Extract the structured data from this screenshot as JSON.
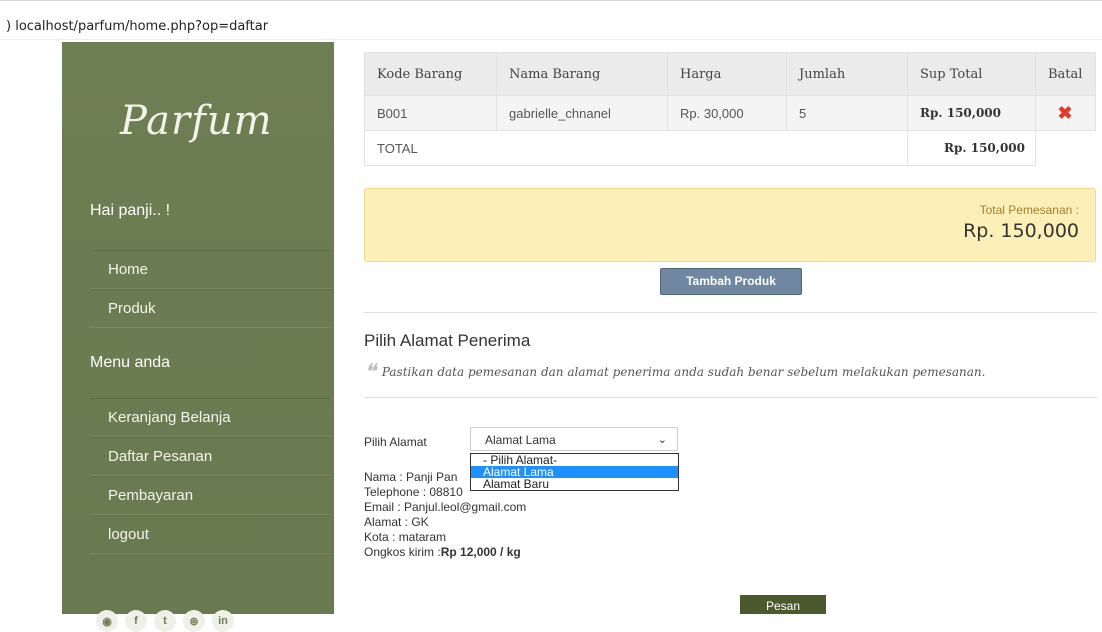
{
  "browser": {
    "url": ") localhost/parfum/home.php?op=daftar"
  },
  "sidebar": {
    "logo": "Parfum",
    "greeting": "Hai panji.. !",
    "main_nav": [
      {
        "label": "Home"
      },
      {
        "label": "Produk"
      }
    ],
    "menu_heading": "Menu anda",
    "user_nav": [
      {
        "label": "Keranjang Belanja"
      },
      {
        "label": "Daftar Pesanan"
      },
      {
        "label": "Pembayaran"
      },
      {
        "label": "logout"
      }
    ],
    "social_icons": [
      "rss-icon",
      "facebook-icon",
      "twitter-icon",
      "dribbble-icon",
      "linkedin-icon"
    ]
  },
  "cart": {
    "headers": [
      "Kode Barang",
      "Nama Barang",
      "Harga",
      "Jumlah",
      "Sup Total",
      "Batal"
    ],
    "rows": [
      {
        "kode": "B001",
        "nama": "gabrielle_chnanel",
        "harga": "Rp. 30,000",
        "jumlah": "5",
        "subtotal": "Rp. 150,000",
        "batal_icon": "delete-x-icon"
      }
    ],
    "total_label": "TOTAL",
    "total_value": "Rp. 150,000"
  },
  "summary": {
    "label": "Total Pemesanan :",
    "amount": "Rp. 150,000"
  },
  "add_product_label": "Tambah Produk",
  "address": {
    "title": "Pilih Alamat Penerima",
    "note": "Pastikan data pemesanan dan alamat penerima anda sudah benar sebelum melakukan pemesanan.",
    "select_label": "Pilih Alamat",
    "selected": "Alamat Lama",
    "options": [
      "- Pilih Alamat-",
      "Alamat Lama",
      "Alamat Baru"
    ],
    "details": {
      "nama": "Nama : Panji Pan",
      "telephone": "Telephone : 08810",
      "email": "Email : Panjul.leol@gmail.com",
      "alamat": "Alamat : GK",
      "kota": "Kota : mataram",
      "ongkos_label": "Ongkos kirim :",
      "ongkos_value": "Rp 12,000 / kg"
    }
  },
  "order_button_label": "Pesan",
  "colors": {
    "sidebar": "#6f7f54",
    "alert_bg": "#fcf0b8",
    "button_blue": "#6f87a0",
    "button_green": "#4a5a2c",
    "delete": "#e03c2e"
  }
}
